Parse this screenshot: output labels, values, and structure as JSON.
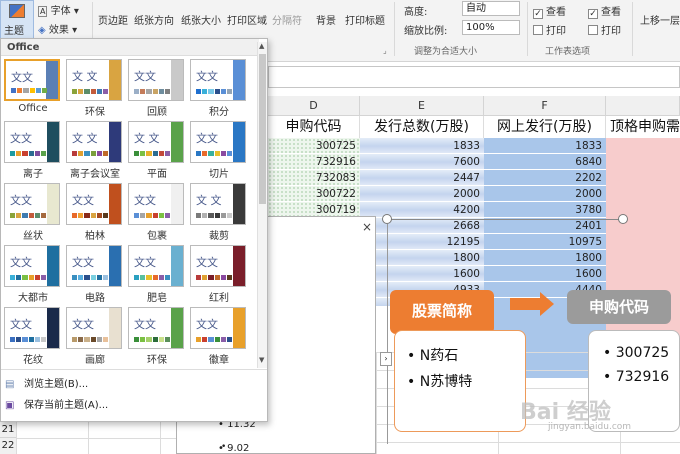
{
  "ribbon": {
    "theme_label": "主题",
    "fonts_label": "字体",
    "effects_label": "效果",
    "margins": "页边距",
    "orientation": "纸张方向",
    "size": "纸张大小",
    "print_area": "打印区域",
    "breaks": "分隔符",
    "background": "背景",
    "print_titles": "打印标题",
    "height_label": "高度:",
    "height_value": "自动",
    "scale_label": "缩放比例:",
    "scale_value": "100%",
    "fit_group": "调整为合适大小",
    "gridlines_view": "查看",
    "gridlines_print": "打印",
    "headings_view": "查看",
    "headings_print": "打印",
    "sheet_options_group": "工作表选项",
    "bring_forward": "上移一层"
  },
  "dropdown": {
    "header": "Office",
    "themes": [
      {
        "name": "Office",
        "text": "文文",
        "bar": "#5b7fb5",
        "c": [
          "#4472c4",
          "#ed7d31",
          "#a5a5a5",
          "#ffc000",
          "#5b9bd5",
          "#70ad47"
        ]
      },
      {
        "name": "环保",
        "text": "文 文",
        "bar": "#d9a441",
        "c": [
          "#8aa33a",
          "#d9a441",
          "#5c8d6a",
          "#c35b3b",
          "#3e7bb0",
          "#8a5ea8"
        ]
      },
      {
        "name": "回顾",
        "text": "文文",
        "bar": "#c9c9c9",
        "c": [
          "#9bafc7",
          "#c47c5a",
          "#a5a5a5",
          "#c9a465",
          "#6e8d9e",
          "#7f7f7f"
        ]
      },
      {
        "name": "积分",
        "text": "文文",
        "bar": "#5a8fd6",
        "c": [
          "#1f6fcf",
          "#3ab0d9",
          "#79c9e8",
          "#2b4f8c",
          "#5a8fd6",
          "#95a5b5"
        ]
      },
      {
        "name": "离子",
        "text": "文文",
        "bar": "#1f4e5f",
        "c": [
          "#1c9aa0",
          "#e8a02a",
          "#c9402e",
          "#2b6c91",
          "#7d4e9e",
          "#5aa24a"
        ]
      },
      {
        "name": "离子会议室",
        "text": "文 文",
        "bar": "#2e3a7a",
        "c": [
          "#b83b3b",
          "#e0a030",
          "#3a8fc0",
          "#7a9e3a",
          "#8a4aa0",
          "#c06a2a"
        ]
      },
      {
        "name": "平面",
        "text": "文 文",
        "bar": "#5aa24a",
        "c": [
          "#3a8f3a",
          "#7bc043",
          "#e8b12a",
          "#2b6c91",
          "#c24a3a",
          "#8a5ea8"
        ]
      },
      {
        "name": "切片",
        "text": "文文",
        "bar": "#2a77c4",
        "c": [
          "#2a77c4",
          "#e86a2a",
          "#3ab09e",
          "#e8c02a",
          "#8a4aa0",
          "#5a8fd6"
        ]
      },
      {
        "name": "丝状",
        "text": "文文",
        "bar": "#e8e8d0",
        "c": [
          "#8aa33a",
          "#d9a441",
          "#3e7bb0",
          "#c35b3b",
          "#5c8d6a",
          "#a56a3e"
        ]
      },
      {
        "name": "柏林",
        "text": "文文",
        "bar": "#c0501e",
        "c": [
          "#e86a2a",
          "#f0a030",
          "#8a2a1a",
          "#d9a441",
          "#a54a1e",
          "#5a3a1e"
        ]
      },
      {
        "name": "包裹",
        "text": "文文",
        "bar": "#f0f0f0",
        "c": [
          "#5a8fd6",
          "#a5a5a5",
          "#e8a02a",
          "#c9402e",
          "#7bc043",
          "#8a5ea8"
        ]
      },
      {
        "name": "裁剪",
        "text": "文 文",
        "bar": "#3a3a3a",
        "c": [
          "#7a7a7a",
          "#b0b0b0",
          "#5a5a5a",
          "#3a3a3a",
          "#9a9a9a",
          "#c9c9c9"
        ]
      },
      {
        "name": "大都市",
        "text": "文文",
        "bar": "#1f6fa0",
        "c": [
          "#3ab0d9",
          "#1f6fa0",
          "#7bc043",
          "#e8a02a",
          "#c9402e",
          "#8a5ea8"
        ]
      },
      {
        "name": "电路",
        "text": "文文",
        "bar": "#2a6fb0",
        "c": [
          "#3a8fc0",
          "#5ab0e0",
          "#2a4f8c",
          "#7ad0e0",
          "#1f6fa0",
          "#9ac0e0"
        ]
      },
      {
        "name": "肥皂",
        "text": "文文",
        "bar": "#6ab0d0",
        "c": [
          "#2aa0c0",
          "#5ac0a0",
          "#e8c02a",
          "#e86a2a",
          "#8a5ea8",
          "#3a8fc0"
        ]
      },
      {
        "name": "红利",
        "text": "文文",
        "bar": "#7a1e2a",
        "c": [
          "#b83b3b",
          "#e0a030",
          "#7a1e2a",
          "#c06a2a",
          "#8a4aa0",
          "#5a3a1e"
        ]
      },
      {
        "name": "花纹",
        "text": "文文",
        "bar": "#1a2a4a",
        "c": [
          "#3a6fc0",
          "#2a4f8c",
          "#5a8fd6",
          "#1f6fa0",
          "#9ac0e0",
          "#c9c9c9"
        ]
      },
      {
        "name": "画廊",
        "text": "文文",
        "bar": "#e8e0d0",
        "c": [
          "#b89a6a",
          "#8a6a4a",
          "#c9b08a",
          "#6a4a2a",
          "#a5a5a5",
          "#e8c09a"
        ]
      },
      {
        "name": "环保",
        "text": "文文",
        "bar": "#5aa24a",
        "c": [
          "#3a8f3a",
          "#7bc043",
          "#a5d06a",
          "#2b6c3a",
          "#c9e08a",
          "#5a8f5a"
        ]
      },
      {
        "name": "徽章",
        "text": "文文",
        "bar": "#e8a02a",
        "c": [
          "#e8a02a",
          "#c9402e",
          "#5a8fd6",
          "#3a8f3a",
          "#8a5ea8",
          "#2a4f8c"
        ]
      }
    ],
    "browse": "浏览主题(B)...",
    "save": "保存当前主题(A)..."
  },
  "sheet": {
    "col_d": "D",
    "col_e": "E",
    "col_f": "F",
    "hdr_d": "申购代码",
    "hdr_e": "发行总数(万股)",
    "hdr_f": "网上发行(万股)",
    "hdr_g": "顶格申购需",
    "d": [
      "300725",
      "732916",
      "732083",
      "300722",
      "300719"
    ],
    "e": [
      "1833",
      "7600",
      "2447",
      "2000",
      "4200",
      "2668",
      "12195",
      "1800",
      "1600",
      "4933"
    ],
    "f": [
      "1833",
      "6840",
      "2202",
      "2000",
      "3780",
      "2401",
      "10975",
      "1800",
      "1600",
      "4440"
    ],
    "rows": [
      "21",
      "22"
    ],
    "left_vals": [
      "11.32",
      "9.02"
    ]
  },
  "smartart": {
    "box1": "股票简称",
    "box1_items": [
      "N药石",
      "N苏博特"
    ],
    "box2": "申购代码",
    "box2_items": [
      "300725",
      "732916"
    ],
    "close": "×"
  },
  "watermark": "Bai 经验",
  "watermark_sub": "jingyan.baidu.com"
}
